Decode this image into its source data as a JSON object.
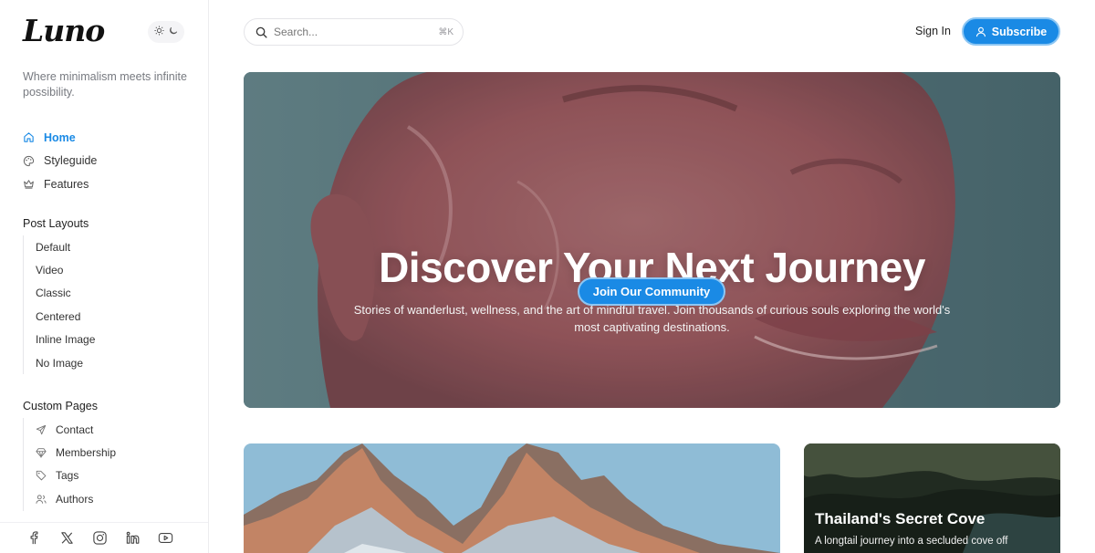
{
  "brand": {
    "logo": "Luno",
    "tagline": "Where minimalism meets infinite possibility."
  },
  "theme_toggle": {
    "light_icon": "sun-icon",
    "dark_icon": "moon-icon"
  },
  "nav": {
    "main": [
      {
        "label": "Home",
        "icon": "home-icon",
        "active": true
      },
      {
        "label": "Styleguide",
        "icon": "palette-icon",
        "active": false
      },
      {
        "label": "Features",
        "icon": "crown-icon",
        "active": false
      }
    ],
    "post_layouts": {
      "title": "Post Layouts",
      "items": [
        "Default",
        "Video",
        "Classic",
        "Centered",
        "Inline Image",
        "No Image"
      ]
    },
    "custom_pages": {
      "title": "Custom Pages",
      "items": [
        {
          "label": "Contact",
          "icon": "send-icon"
        },
        {
          "label": "Membership",
          "icon": "diamond-icon"
        },
        {
          "label": "Tags",
          "icon": "tag-icon"
        },
        {
          "label": "Authors",
          "icon": "users-icon"
        }
      ]
    }
  },
  "social": [
    "facebook-icon",
    "x-icon",
    "instagram-icon",
    "linkedin-icon",
    "youtube-icon"
  ],
  "header": {
    "search_placeholder": "Search...",
    "search_shortcut": "⌘K",
    "signin_label": "Sign In",
    "subscribe_label": "Subscribe"
  },
  "hero": {
    "title": "Discover Your Next Journey",
    "description": "Stories of wanderlust, wellness, and the art of mindful travel. Join thousands of curious souls exploring the world's most captivating destinations.",
    "cta": "Join Our Community"
  },
  "cards": [
    {
      "title": "",
      "description": ""
    },
    {
      "title": "Thailand's Secret Cove",
      "description": "A longtail journey into a secluded cove off"
    }
  ],
  "colors": {
    "accent": "#1a8ae5",
    "accent_ring": "#8cc6f3",
    "hero_bg": "#5f8189"
  }
}
